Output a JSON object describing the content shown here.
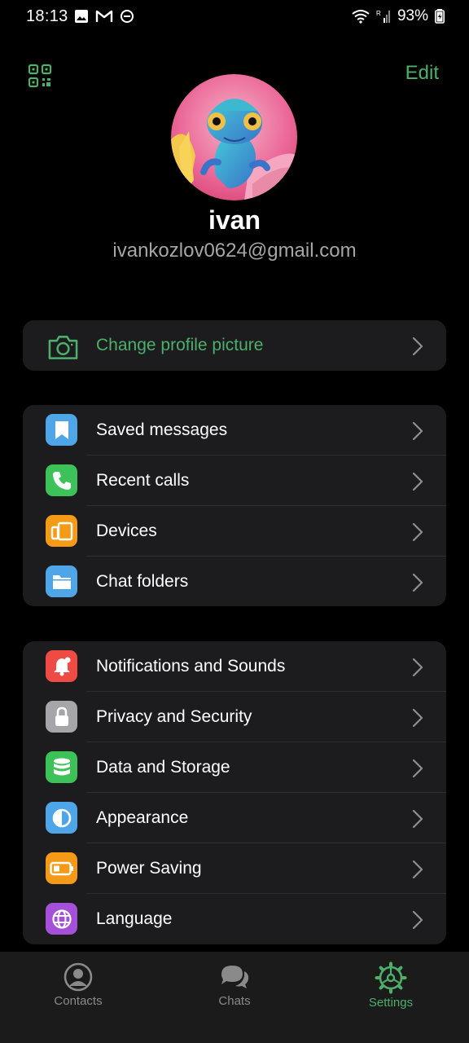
{
  "status_bar": {
    "time": "18:13",
    "battery": "93%",
    "left_icons": [
      "image-icon",
      "gmail-icon",
      "dnd-icon"
    ],
    "right_icons": [
      "wifi-icon",
      "signal-icon",
      "battery-icon"
    ]
  },
  "header": {
    "edit_label": "Edit"
  },
  "profile": {
    "name": "ivan",
    "email": "ivankozlov0624@gmail.com"
  },
  "change_picture": {
    "label": "Change profile picture",
    "icon": "camera-icon"
  },
  "group1": [
    {
      "label": "Saved messages",
      "icon": "bookmark-icon",
      "color": "#4ea6e8"
    },
    {
      "label": "Recent calls",
      "icon": "phone-icon",
      "color": "#3dc25a"
    },
    {
      "label": "Devices",
      "icon": "devices-icon",
      "color": "#f59a16"
    },
    {
      "label": "Chat folders",
      "icon": "folder-icon",
      "color": "#4ea6e8"
    }
  ],
  "group2": [
    {
      "label": "Notifications and Sounds",
      "icon": "bell-icon",
      "color": "#ef4b45"
    },
    {
      "label": "Privacy and Security",
      "icon": "lock-icon",
      "color": "#a6a6aa"
    },
    {
      "label": "Data and Storage",
      "icon": "database-icon",
      "color": "#3dc25a"
    },
    {
      "label": "Appearance",
      "icon": "contrast-icon",
      "color": "#4ea6e8"
    },
    {
      "label": "Power Saving",
      "icon": "battery-icon",
      "color": "#f59a16"
    },
    {
      "label": "Language",
      "icon": "globe-icon",
      "color": "#a450d8"
    }
  ],
  "bottom_nav": {
    "contacts": "Contacts",
    "chats": "Chats",
    "settings": "Settings",
    "active": "Settings"
  },
  "colors": {
    "accent": "#4caf6a",
    "card": "#1c1c1e",
    "background": "#000000"
  }
}
